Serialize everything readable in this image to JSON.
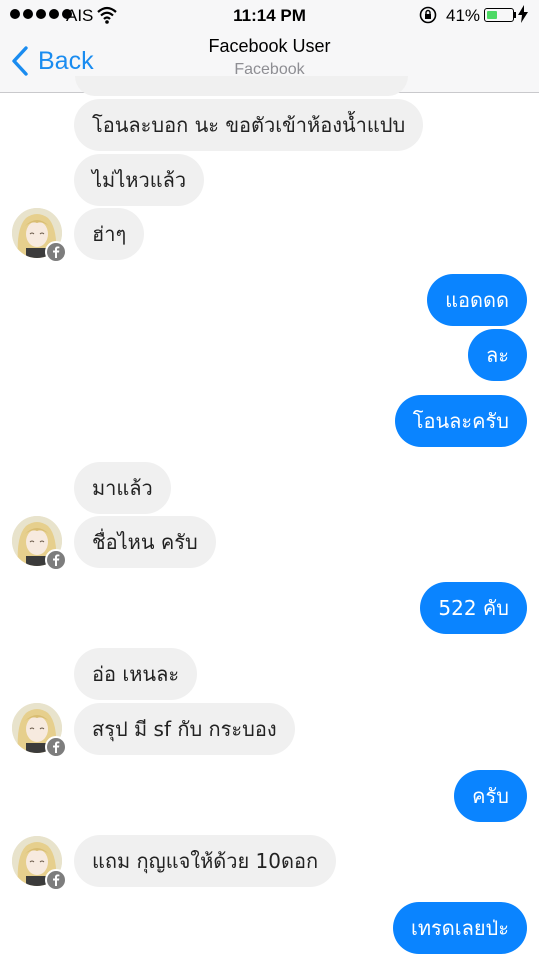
{
  "status_bar": {
    "carrier": "AIS",
    "time": "11:14 PM",
    "battery_percent": "41%",
    "battery_level": 0.41
  },
  "nav": {
    "back_label": "Back",
    "title": "Facebook User",
    "subtitle": "Facebook"
  },
  "messages": [
    {
      "direction": "incoming",
      "text": "โอนละบอก นะ ขอตัวเข้าห้องน้ำแปบ"
    },
    {
      "direction": "incoming",
      "text": "ไม่ไหวแล้ว"
    },
    {
      "direction": "incoming",
      "text": "ฮ่าๆ"
    },
    {
      "direction": "outgoing",
      "text": "แอดดด"
    },
    {
      "direction": "outgoing",
      "text": "ละ"
    },
    {
      "direction": "outgoing",
      "text": "โอนละครับ"
    },
    {
      "direction": "incoming",
      "text": "มาแล้ว"
    },
    {
      "direction": "incoming",
      "text": "ชื่อไหน ครับ"
    },
    {
      "direction": "outgoing",
      "text": "522 คับ"
    },
    {
      "direction": "incoming",
      "text": "อ่อ เหนละ"
    },
    {
      "direction": "incoming",
      "text": "สรุป มี sf กับ กระบอง"
    },
    {
      "direction": "outgoing",
      "text": "ครับ"
    },
    {
      "direction": "incoming",
      "text": "แถม กุญแจให้ด้วย 10ดอก"
    },
    {
      "direction": "outgoing",
      "text": "เทรดเลยป่ะ"
    }
  ],
  "icons": {
    "back": "chevron-left-icon",
    "wifi": "wifi-icon",
    "lock": "rotation-lock-icon",
    "battery": "battery-icon",
    "charge": "charging-bolt-icon",
    "avatar_badge": "facebook-icon"
  },
  "colors": {
    "outgoing_bubble": "#0a84ff",
    "incoming_bubble": "#f0f0f0",
    "accent": "#1a8cf0",
    "battery_fill": "#4cd964"
  }
}
